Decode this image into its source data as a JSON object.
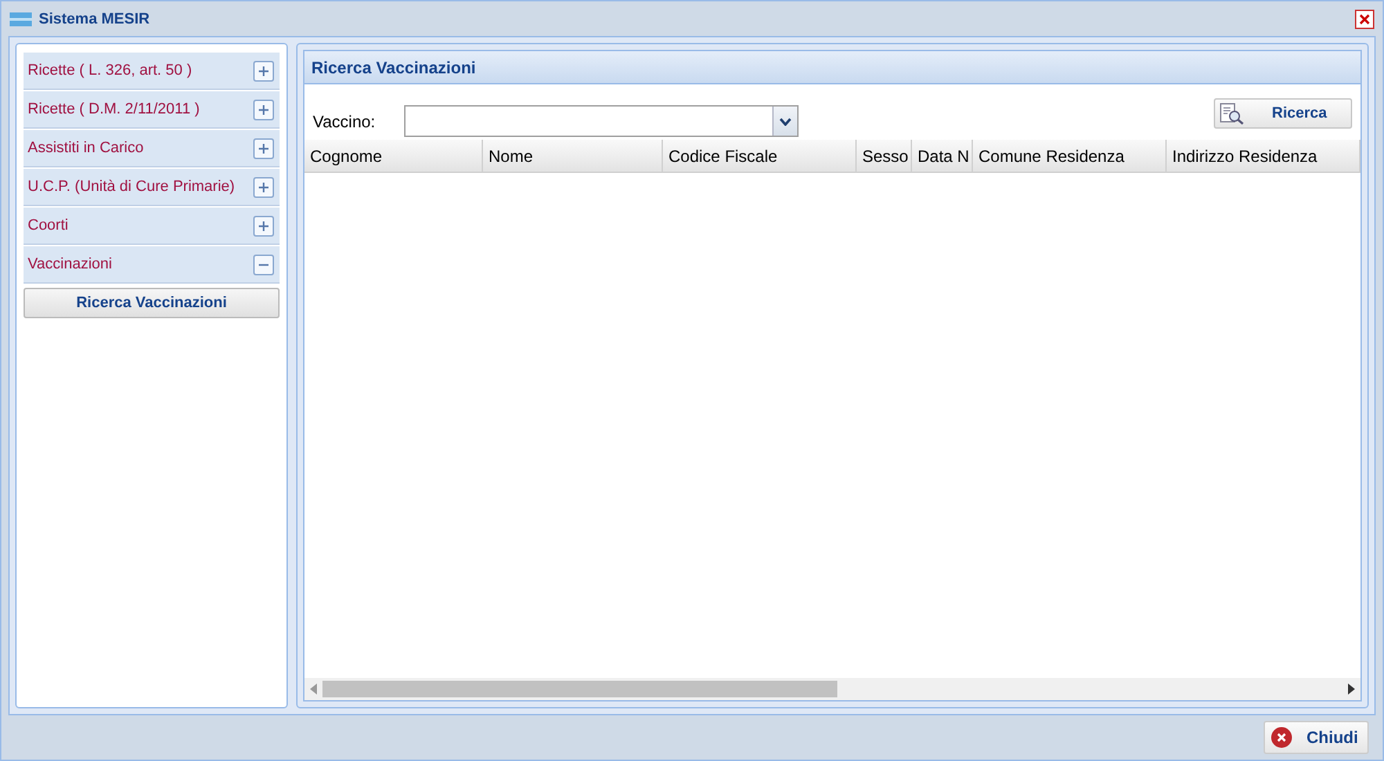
{
  "window": {
    "title": "Sistema MESIR"
  },
  "sidebar": {
    "items": [
      {
        "label": "Ricette ( L. 326, art. 50 )",
        "expanded": false
      },
      {
        "label": "Ricette ( D.M. 2/11/2011 )",
        "expanded": false
      },
      {
        "label": "Assistiti in Carico",
        "expanded": false
      },
      {
        "label": "U.C.P. (Unità di Cure Primarie)",
        "expanded": false
      },
      {
        "label": "Coorti",
        "expanded": false
      },
      {
        "label": "Vaccinazioni",
        "expanded": true,
        "children": [
          {
            "label": "Ricerca Vaccinazioni"
          }
        ]
      }
    ]
  },
  "panel": {
    "title": "Ricerca Vaccinazioni",
    "filter_label": "Vaccino:",
    "search_button": "Ricerca",
    "table": {
      "columns": [
        {
          "label": "Cognome"
        },
        {
          "label": "Nome"
        },
        {
          "label": "Codice Fiscale"
        },
        {
          "label": "Sesso"
        },
        {
          "label": "Data N"
        },
        {
          "label": "Comune Residenza"
        },
        {
          "label": "Indirizzo Residenza"
        }
      ]
    }
  },
  "footer": {
    "close_button": "Chiudi"
  }
}
